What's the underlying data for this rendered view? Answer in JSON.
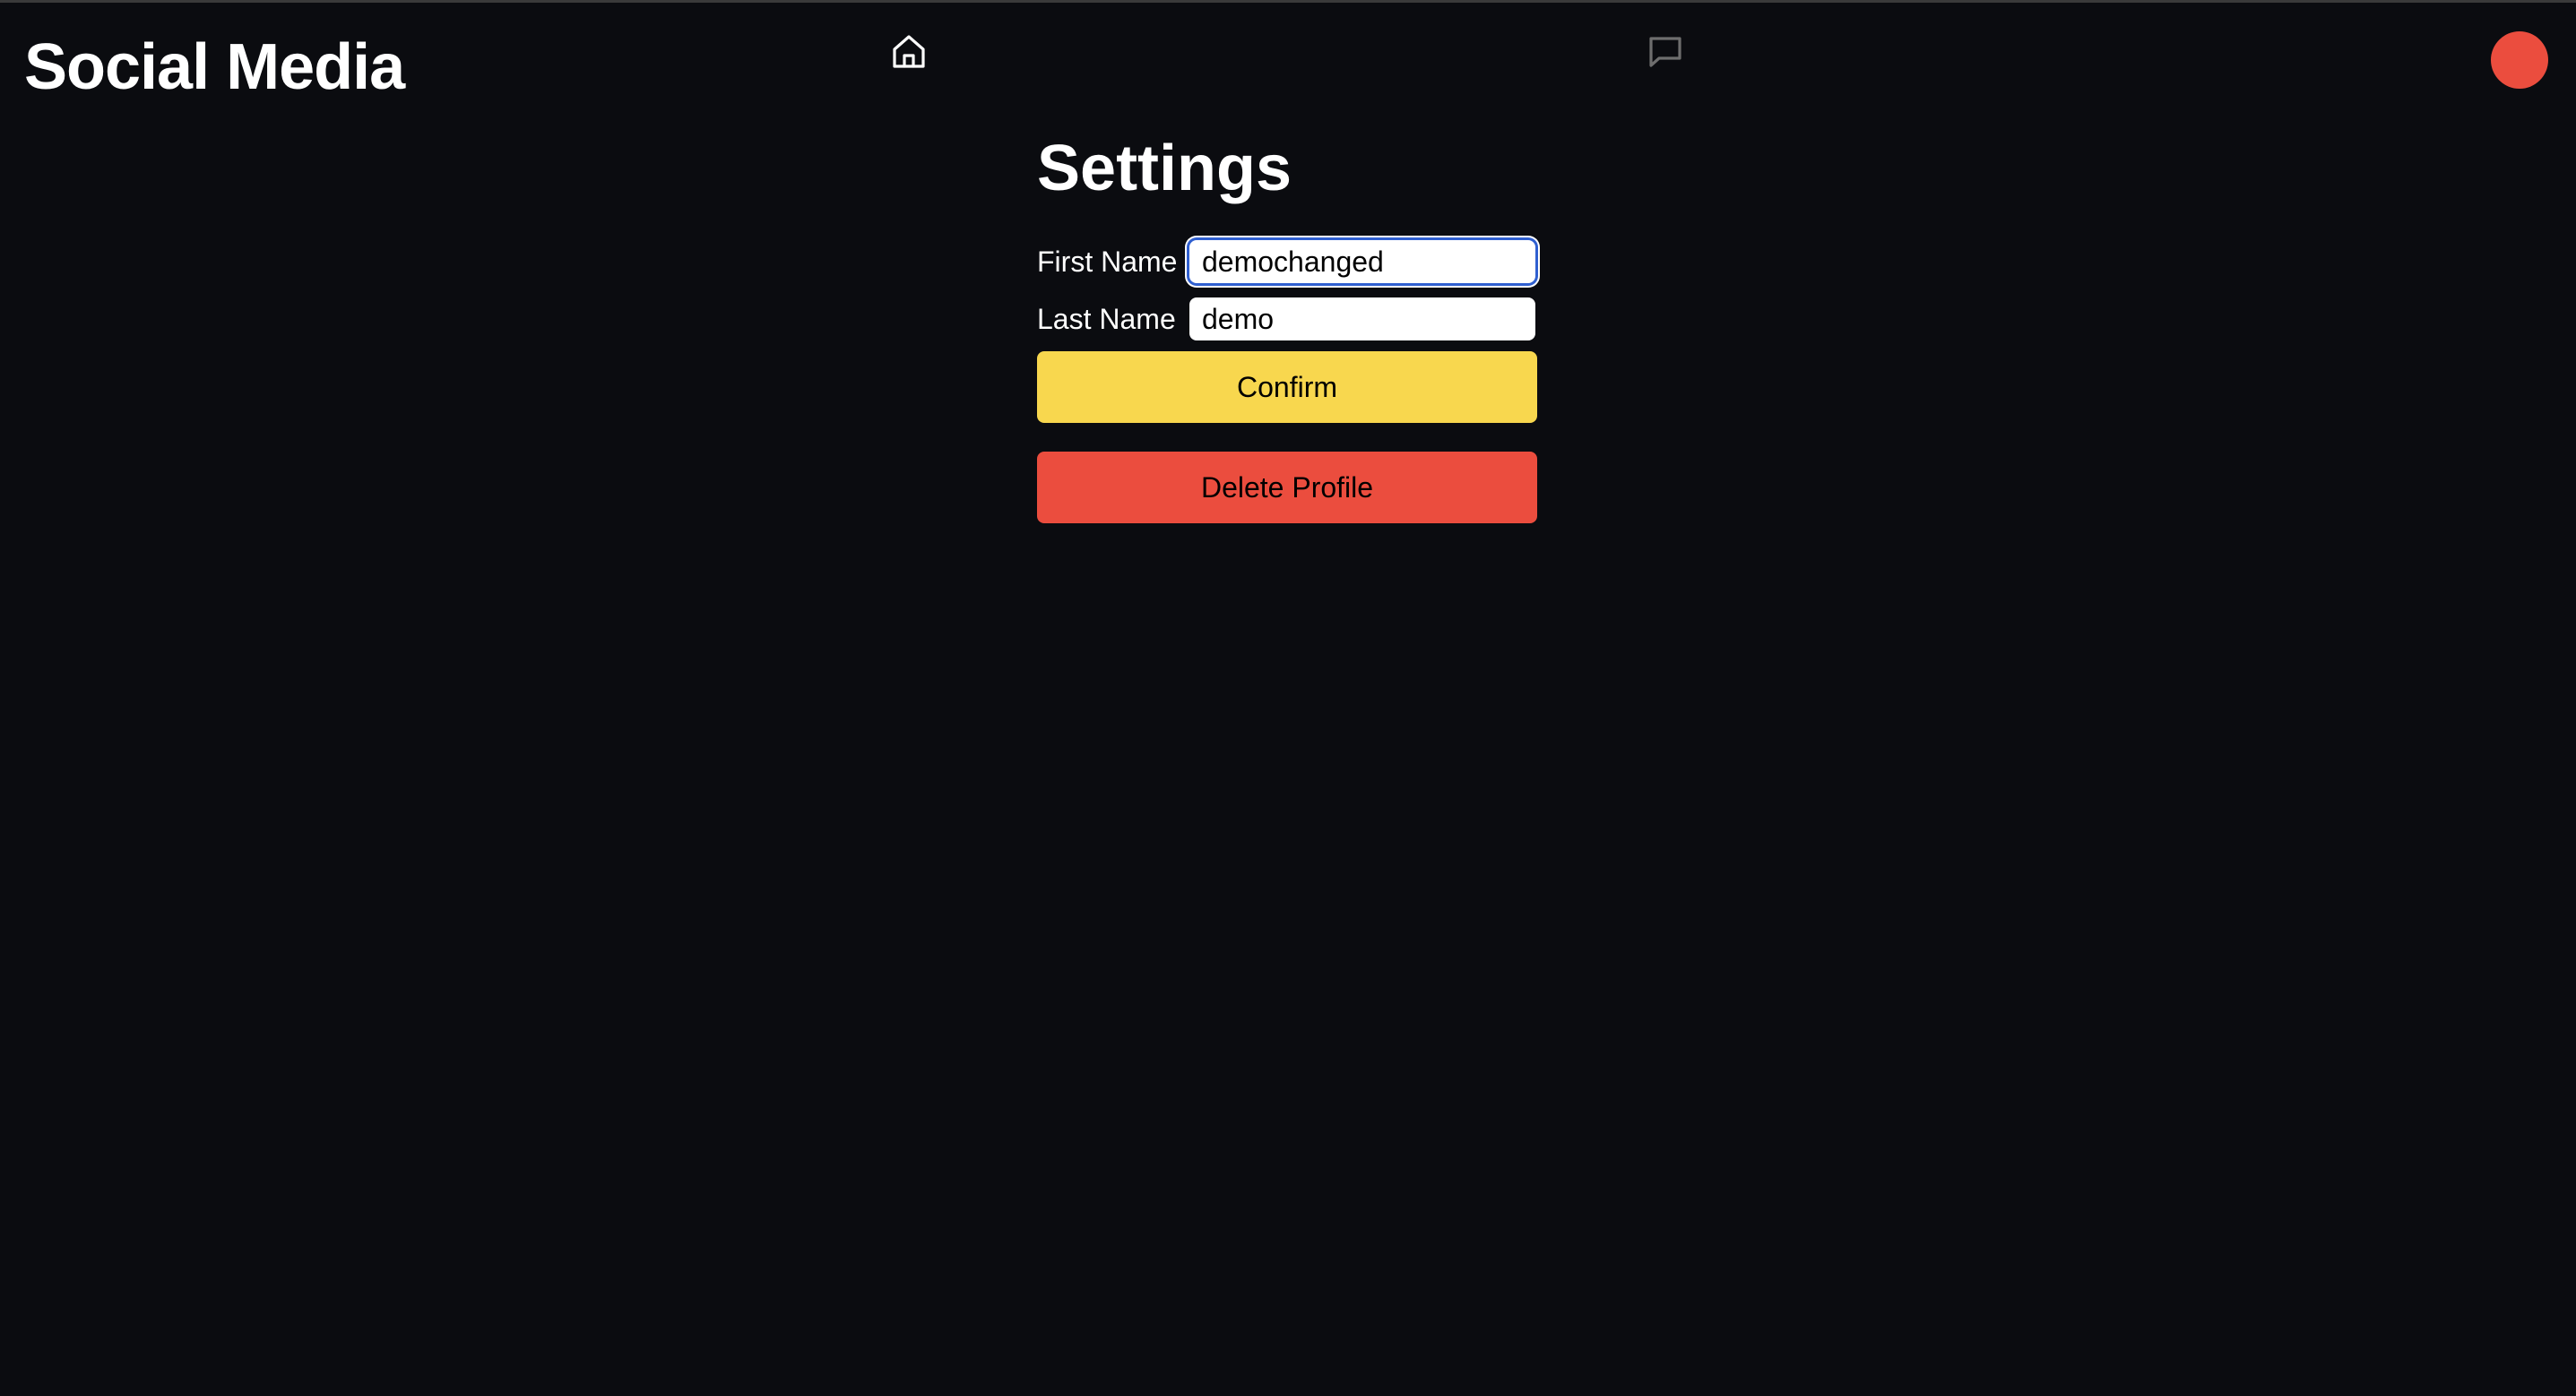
{
  "header": {
    "brand": "Social Media",
    "nav": {
      "home_icon": "home-icon",
      "chat_icon": "message-square-icon"
    },
    "avatar_color": "#eb4d3e"
  },
  "settings": {
    "title": "Settings",
    "first_name_label": "First Name",
    "first_name_value": "demochanged",
    "last_name_label": "Last Name",
    "last_name_value": "demo",
    "confirm_label": "Confirm",
    "delete_label": "Delete Profile"
  },
  "colors": {
    "background": "#0b0c10",
    "confirm": "#f8d74e",
    "delete": "#eb4d3e",
    "focus_ring": "#2f5fd0"
  }
}
